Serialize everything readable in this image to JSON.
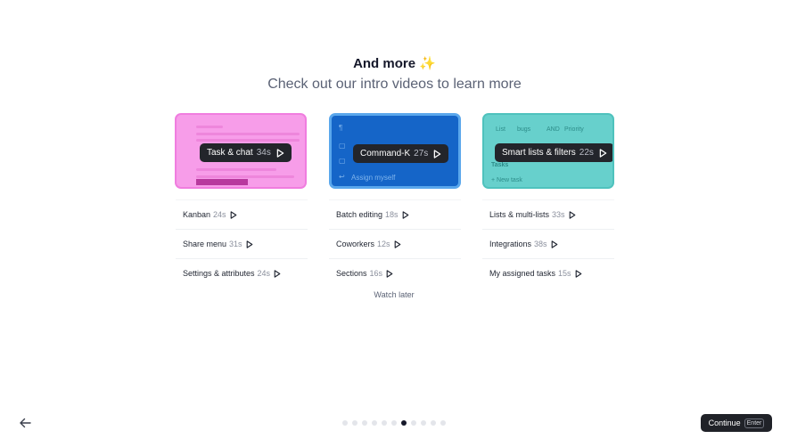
{
  "header": {
    "title": "And more",
    "sparkle": "✨",
    "subtitle": "Check out our intro videos to learn more"
  },
  "cards": [
    {
      "label": "Task & chat",
      "duration": "34s"
    },
    {
      "label": "Command-K",
      "duration": "27s",
      "inner_text": "Assign myself"
    },
    {
      "label": "Smart lists & filters",
      "duration": "22s",
      "inner": {
        "list": "List",
        "bugs": "bugs",
        "and": "AND",
        "priority": "Priority",
        "tasks": "Tasks",
        "new_task": "+ New task"
      }
    }
  ],
  "columns": [
    [
      {
        "label": "Kanban",
        "duration": "24s"
      },
      {
        "label": "Share menu",
        "duration": "31s"
      },
      {
        "label": "Settings & attributes",
        "duration": "24s"
      }
    ],
    [
      {
        "label": "Batch editing",
        "duration": "18s"
      },
      {
        "label": "Coworkers",
        "duration": "12s"
      },
      {
        "label": "Sections",
        "duration": "16s"
      }
    ],
    [
      {
        "label": "Lists & multi-lists",
        "duration": "33s"
      },
      {
        "label": "Integrations",
        "duration": "38s"
      },
      {
        "label": "My assigned tasks",
        "duration": "15s"
      }
    ]
  ],
  "watch_later": "Watch later",
  "footer": {
    "continue_label": "Continue",
    "enter_key": "Enter",
    "page_count": 11,
    "active_page": 7
  }
}
